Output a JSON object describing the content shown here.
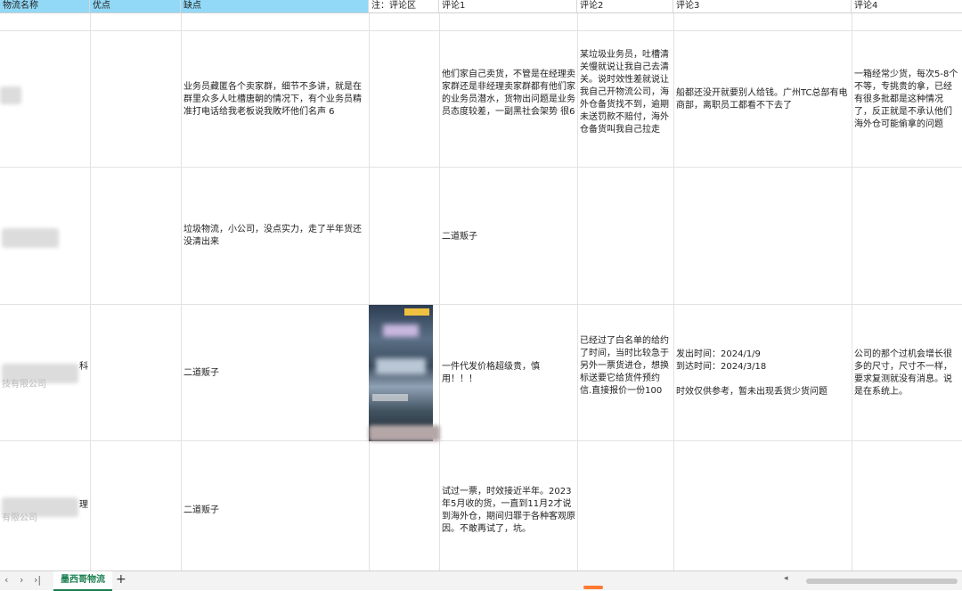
{
  "headers": {
    "name": "物流名称",
    "pros": "优点",
    "cons": "缺点",
    "note": "注：评论区",
    "c1": "评论1",
    "c2": "评论2",
    "c3": "评论3",
    "c4": "评论4"
  },
  "rows": [
    {
      "name": "",
      "cons": "业务员藏匿各个卖家群，细节不多讲，就是在群里众多人吐槽唐朝的情况下，有个业务员精准打电话给我老板说我敗坏他们名声 6",
      "c1": "他们家自己卖货，不管是在经理卖家群还是非经理卖家群都有他们家的业务员潜水，货物出问题是业务员态度较差，一副黑社会架势 很6",
      "c2": "某垃圾业务员，吐槽清关慢就说让我自己去清关。说时效性差就说让我自己开物流公司，海外仓备货找不到，逾期未送罚款不赔付，海外仓备货叫我自己拉走",
      "c3": "船都还没开就要别人给钱。广州TC总部有电商部，离职员工都看不下去了",
      "c4": "一箱经常少货，每次5-8个不等，专挑贵的拿，已经有很多批都是这种情况了，反正就是不承认他们海外仓可能偷拿的问题"
    },
    {
      "name": "",
      "cons": "垃圾物流，小公司，没点实力，走了半年货还没清出来",
      "c1": "二道贩子",
      "c2": "",
      "c3": "",
      "c4": ""
    },
    {
      "name_frag1": "科",
      "name_frag2": "技有限公司",
      "cons": "二道贩子",
      "c1": "一件代发价格超级贵，慎用！！！",
      "c2": "已经过了白名单的给约了时间，当时比较急于另外一票货进仓，想换标送要它给货件预约信.直接报价一份100",
      "c3_l1": "发出时间：2024/1/9",
      "c3_l2": "到达时间：2024/3/18",
      "c3_l3": "时效仅供参考，暂未出现丢货少货问题",
      "c4": "公司的那个过机会增长很多的尺寸，尺寸不一样，要求复测就没有消息。说是在系统上。"
    },
    {
      "name_frag1": "理",
      "name_frag2": "有限公司",
      "cons": "二道贩子",
      "c1": "试过一票，时效接近半年。2023年5月收的货，一直到11月2才说到海外仓，期间归罪于各种客观原因。不敢再试了，坑。",
      "c2": "",
      "c3": "",
      "c4": ""
    }
  ],
  "footer": {
    "sheet_name": "墨西哥物流",
    "add": "+",
    "nav_prev": "‹",
    "nav_next": "›",
    "nav_last": "›|"
  },
  "colors": {
    "header_blue": "#92d9f7",
    "tab_green": "#1a7f4f"
  }
}
